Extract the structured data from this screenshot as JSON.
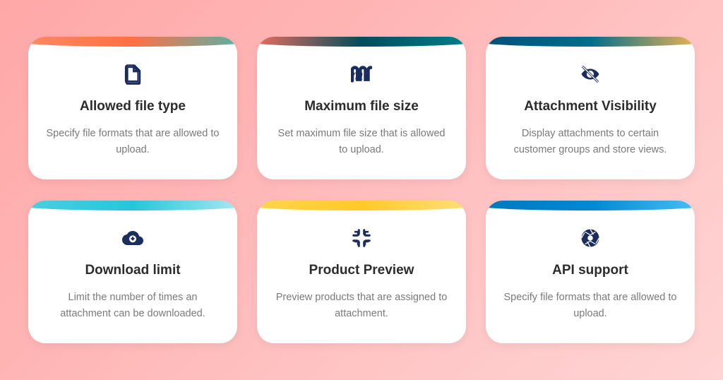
{
  "cards": [
    {
      "icon": "file",
      "title": "Allowed file type",
      "desc": "Specify file formats that are allowed to upload."
    },
    {
      "icon": "m-logo",
      "title": "Maximum file size",
      "desc": "Set maximum file size that is allowed to upload."
    },
    {
      "icon": "eye-off",
      "title": "Attachment Visibility",
      "desc": "Display attachments to certain customer groups and store views."
    },
    {
      "icon": "cloud-download",
      "title": "Download limit",
      "desc": "Limit the number of times an attachment can be downloaded."
    },
    {
      "icon": "minimize",
      "title": "Product Preview",
      "desc": "Preview products that are assigned to attachment."
    },
    {
      "icon": "aperture",
      "title": "API support",
      "desc": "Specify file formats that are allowed to upload."
    }
  ]
}
